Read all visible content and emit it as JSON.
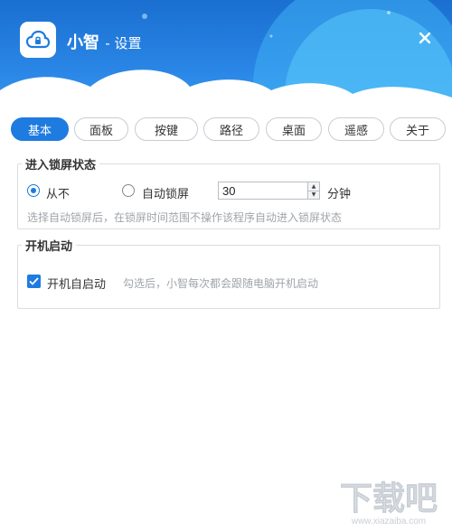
{
  "header": {
    "app_name": "小智",
    "subtitle": "- 设置"
  },
  "tabs": [
    {
      "label": "基本",
      "active": true
    },
    {
      "label": "面板",
      "active": false
    },
    {
      "label": "按键",
      "active": false
    },
    {
      "label": "路径",
      "active": false
    },
    {
      "label": "桌面",
      "active": false
    },
    {
      "label": "遥感",
      "active": false
    },
    {
      "label": "关于",
      "active": false
    }
  ],
  "lock_section": {
    "title": "进入锁屏状态",
    "option_never": "从不",
    "option_auto": "自动锁屏",
    "selected": "从不",
    "minutes_value": "30",
    "unit": "分钟",
    "hint": "选择自动锁屏后，在锁屏时间范围不操作该程序自动进入锁屏状态"
  },
  "startup_section": {
    "title": "开机启动",
    "checkbox_label": "开机自启动",
    "checked": true,
    "hint": "勾选后，小智每次都会跟随电脑开机启动"
  },
  "watermark": {
    "text": "下载吧",
    "url_text": "www.xiazaiba.com"
  },
  "colors": {
    "accent": "#1e7be0",
    "header_dark": "#1a6fd0",
    "header_light": "#3a9cf0"
  }
}
